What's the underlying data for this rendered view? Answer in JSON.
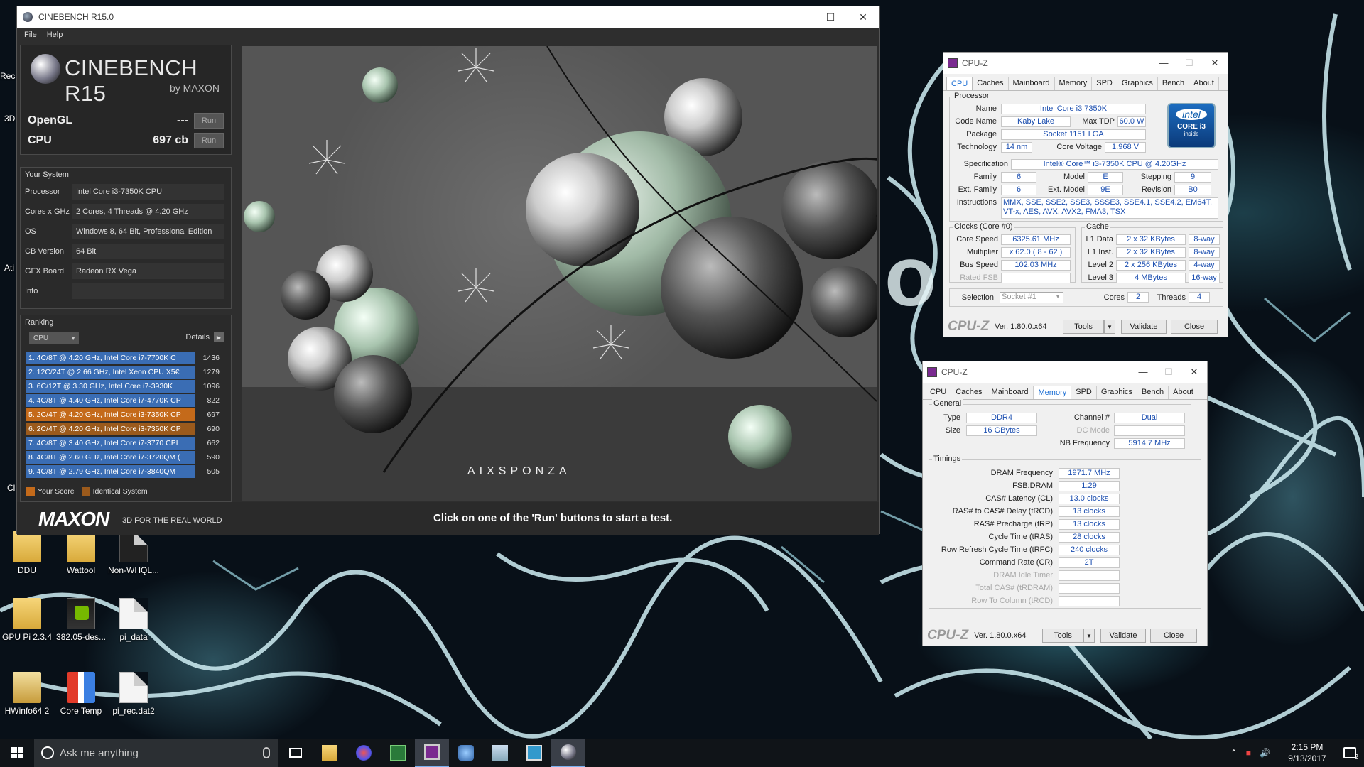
{
  "desktop": {
    "icons": [
      {
        "label": "DDU",
        "type": "folder"
      },
      {
        "label": "Wattool",
        "type": "folder"
      },
      {
        "label": "Non-WHQL...",
        "type": "doc"
      },
      {
        "label": "GPU Pi 2.3.4",
        "type": "folder"
      },
      {
        "label": "382.05-des...",
        "type": "nv"
      },
      {
        "label": "pi_data",
        "type": "doc"
      },
      {
        "label": "HWinfo64 2",
        "type": "hw"
      },
      {
        "label": "Core Temp",
        "type": "temp"
      },
      {
        "label": "pi_rec.dat2",
        "type": "doc"
      }
    ],
    "edge_labels": [
      "Rec",
      "3D",
      "Ati",
      "Cl"
    ]
  },
  "cinebench": {
    "title": "CINEBENCH R15.0",
    "menu": [
      "File",
      "Help"
    ],
    "logo_name": "CINEBENCH R15",
    "logo_by": "by MAXON",
    "opengl": {
      "label": "OpenGL",
      "value": "---",
      "run": "Run"
    },
    "cpu": {
      "label": "CPU",
      "value": "697 cb",
      "run": "Run"
    },
    "your_system_title": "Your System",
    "system": [
      {
        "k": "Processor",
        "v": "Intel Core i3-7350K CPU"
      },
      {
        "k": "Cores x GHz",
        "v": "2 Cores, 4 Threads @ 4.20 GHz"
      },
      {
        "k": "OS",
        "v": "Windows 8, 64 Bit, Professional Edition"
      },
      {
        "k": "CB Version",
        "v": "64 Bit"
      },
      {
        "k": "GFX Board",
        "v": "Radeon RX Vega"
      },
      {
        "k": "Info",
        "v": ""
      }
    ],
    "ranking_title": "Ranking",
    "ranking_select": "CPU",
    "details": "Details",
    "ranking": [
      {
        "label": "1. 4C/8T @ 4.20 GHz, Intel Core i7-7700K C",
        "score": "1436",
        "style": "blue"
      },
      {
        "label": "2. 12C/24T @ 2.66 GHz, Intel Xeon CPU X5€",
        "score": "1279",
        "style": "blue"
      },
      {
        "label": "3. 6C/12T @ 3.30 GHz,  Intel Core i7-3930K",
        "score": "1096",
        "style": "blue"
      },
      {
        "label": "4. 4C/8T @ 4.40 GHz, Intel Core i7-4770K CP",
        "score": "822",
        "style": "blue"
      },
      {
        "label": "5. 2C/4T @ 4.20 GHz, Intel Core i3-7350K CP",
        "score": "697",
        "style": "orange"
      },
      {
        "label": "6. 2C/4T @ 4.20 GHz, Intel Core i3-7350K CP",
        "score": "690",
        "style": "dorange"
      },
      {
        "label": "7. 4C/8T @ 3.40 GHz,  Intel Core i7-3770 CPL",
        "score": "662",
        "style": "blue"
      },
      {
        "label": "8. 4C/8T @ 2.60 GHz, Intel Core i7-3720QM (",
        "score": "590",
        "style": "blue"
      },
      {
        "label": "9. 4C/8T @ 2.79 GHz,  Intel Core i7-3840QM",
        "score": "505",
        "style": "blue"
      }
    ],
    "legend_your_score": "Your Score",
    "legend_identical": "Identical System",
    "maxon": "MAXON",
    "maxon_sub": "3D FOR THE REAL WORLD",
    "message": "Click on one of the 'Run' buttons to start a test.",
    "render_brand": "AIXSPONZA"
  },
  "cpuz1": {
    "title": "CPU-Z",
    "tabs": [
      "CPU",
      "Caches",
      "Mainboard",
      "Memory",
      "SPD",
      "Graphics",
      "Bench",
      "About"
    ],
    "active_tab": "CPU",
    "processor_title": "Processor",
    "name_label": "Name",
    "name": "Intel Core i3 7350K",
    "codename_label": "Code Name",
    "codename": "Kaby Lake",
    "maxtdp_label": "Max TDP",
    "maxtdp": "60.0 W",
    "package_label": "Package",
    "package": "Socket 1151 LGA",
    "tech_label": "Technology",
    "tech": "14 nm",
    "voltage_label": "Core Voltage",
    "voltage": "1.968 V",
    "spec_label": "Specification",
    "spec": "Intel® Core™ i3-7350K CPU @ 4.20GHz",
    "family_label": "Family",
    "family": "6",
    "model_label": "Model",
    "model": "E",
    "stepping_label": "Stepping",
    "stepping": "9",
    "extfamily_label": "Ext. Family",
    "extfamily": "6",
    "extmodel_label": "Ext. Model",
    "extmodel": "9E",
    "revision_label": "Revision",
    "revision": "B0",
    "instr_label": "Instructions",
    "instr": "MMX, SSE, SSE2, SSE3, SSSE3, SSE4.1, SSE4.2, EM64T, VT-x, AES, AVX, AVX2, FMA3, TSX",
    "clocks_title": "Clocks (Core #0)",
    "corespeed_label": "Core Speed",
    "corespeed": "6325.61 MHz",
    "mult_label": "Multiplier",
    "mult": "x 62.0 ( 8 - 62 )",
    "bus_label": "Bus Speed",
    "bus": "102.03 MHz",
    "fsb_label": "Rated FSB",
    "cache_title": "Cache",
    "l1d_label": "L1 Data",
    "l1d": "2 x 32 KBytes",
    "l1d_way": "8-way",
    "l1i_label": "L1 Inst.",
    "l1i": "2 x 32 KBytes",
    "l1i_way": "8-way",
    "l2_label": "Level 2",
    "l2": "2 x 256 KBytes",
    "l2_way": "4-way",
    "l3_label": "Level 3",
    "l3": "4 MBytes",
    "l3_way": "16-way",
    "selection_label": "Selection",
    "selection": "Socket #1",
    "cores_label": "Cores",
    "cores": "2",
    "threads_label": "Threads",
    "threads": "4",
    "logo": "CPU-Z",
    "version": "Ver. 1.80.0.x64",
    "tools": "Tools",
    "validate": "Validate",
    "close": "Close",
    "intel_logo": "intel",
    "intel_core": "CORE i3",
    "intel_inside": "inside"
  },
  "cpuz2": {
    "title": "CPU-Z",
    "tabs": [
      "CPU",
      "Caches",
      "Mainboard",
      "Memory",
      "SPD",
      "Graphics",
      "Bench",
      "About"
    ],
    "active_tab": "Memory",
    "general_title": "General",
    "type_label": "Type",
    "type": "DDR4",
    "channel_label": "Channel #",
    "channel": "Dual",
    "size_label": "Size",
    "size": "16 GBytes",
    "dcmode_label": "DC Mode",
    "nbfreq_label": "NB Frequency",
    "nbfreq": "5914.7 MHz",
    "timings_title": "Timings",
    "timings": [
      {
        "k": "DRAM Frequency",
        "v": "1971.7 MHz",
        "dim": false
      },
      {
        "k": "FSB:DRAM",
        "v": "1:29",
        "dim": false
      },
      {
        "k": "CAS# Latency (CL)",
        "v": "13.0 clocks",
        "dim": false
      },
      {
        "k": "RAS# to CAS# Delay (tRCD)",
        "v": "13 clocks",
        "dim": false
      },
      {
        "k": "RAS# Precharge (tRP)",
        "v": "13 clocks",
        "dim": false
      },
      {
        "k": "Cycle Time (tRAS)",
        "v": "28 clocks",
        "dim": false
      },
      {
        "k": "Row Refresh Cycle Time (tRFC)",
        "v": "240 clocks",
        "dim": false
      },
      {
        "k": "Command Rate (CR)",
        "v": "2T",
        "dim": false
      },
      {
        "k": "DRAM Idle Timer",
        "v": "",
        "dim": true
      },
      {
        "k": "Total CAS# (tRDRAM)",
        "v": "",
        "dim": true
      },
      {
        "k": "Row To Column (tRCD)",
        "v": "",
        "dim": true
      }
    ],
    "logo": "CPU-Z",
    "version": "Ver. 1.80.0.x64",
    "tools": "Tools",
    "validate": "Validate",
    "close": "Close"
  },
  "taskbar": {
    "search_placeholder": "Ask me anything",
    "time": "2:15 PM",
    "date": "9/13/2017",
    "notification_count": "2",
    "accent": "#7ab0f0"
  }
}
